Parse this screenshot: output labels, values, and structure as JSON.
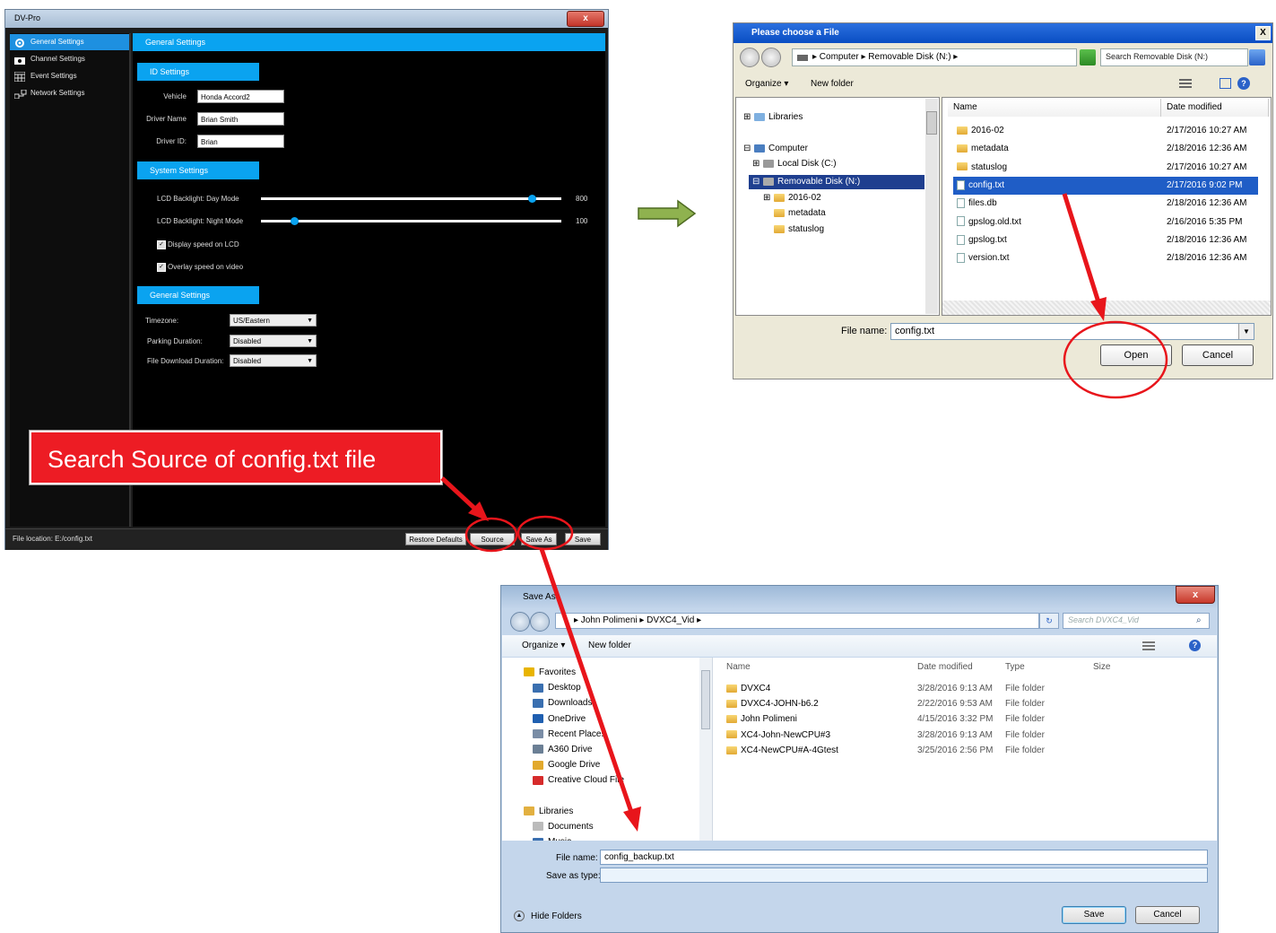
{
  "dvpro": {
    "title": "DV-Pro",
    "close_glyph": "x",
    "nav": [
      {
        "label": "General Settings",
        "icon": "gear-icon",
        "selected": true
      },
      {
        "label": "Channel Settings",
        "icon": "camera-icon",
        "selected": false
      },
      {
        "label": "Event Settings",
        "icon": "calendar-icon",
        "selected": false
      },
      {
        "label": "Network Settings",
        "icon": "network-icon",
        "selected": false
      }
    ],
    "header": "General Settings",
    "id_section": {
      "title": "ID Settings",
      "vehicle_label": "Vehicle",
      "vehicle_value": "Honda Accord2",
      "driver_name_label": "Driver Name",
      "driver_name_value": "Brian Smith",
      "driver_id_label": "Driver ID:",
      "driver_id_value": "Brian"
    },
    "system_section": {
      "title": "System Settings",
      "day_label": "LCD Backlight: Day Mode",
      "day_value": "800",
      "day_level": 0.9,
      "night_label": "LCD Backlight: Night Mode",
      "night_value": "100",
      "night_level": 0.11,
      "display_speed_label": "Display speed on LCD",
      "overlay_speed_label": "Overlay speed on video",
      "check_glyph": "✓"
    },
    "general_section": {
      "title": "General Settings",
      "timezone_label": "Timezone:",
      "timezone_value": "US/Eastern",
      "parking_label": "Parking Duration:",
      "parking_value": "Disabled",
      "download_label": "File Download Duration:",
      "download_value": "Disabled",
      "arrow_glyph": "▼"
    },
    "status": "File location: E:/config.txt",
    "buttons": {
      "restore": "Restore Defaults",
      "source": "Source",
      "saveas": "Save As",
      "save": "Save"
    }
  },
  "callout": "Search Source of config.txt file",
  "open_dialog": {
    "title": "Please choose a File",
    "close_glyph": "X",
    "breadcrumb": "▸ Computer ▸ Removable Disk (N:) ▸",
    "search_placeholder": "Search Removable Disk (N:)",
    "organize": "Organize ▾",
    "new_folder": "New folder",
    "tree": [
      {
        "label": "Libraries",
        "expander": "⊞"
      },
      {
        "label": "Computer",
        "expander": "⊟"
      },
      {
        "label": "Local Disk (C:)",
        "expander": "⊞"
      },
      {
        "label": "Removable Disk (N:)",
        "expander": "⊟"
      },
      {
        "label": "2016-02",
        "expander": "⊞"
      },
      {
        "label": "metadata",
        "expander": ""
      },
      {
        "label": "statuslog",
        "expander": ""
      }
    ],
    "col_name": "Name",
    "col_date": "Date modified",
    "files": [
      {
        "name": "2016-02",
        "date": "2/17/2016 10:27 AM",
        "kind": "folder"
      },
      {
        "name": "metadata",
        "date": "2/18/2016 12:36 AM",
        "kind": "folder"
      },
      {
        "name": "statuslog",
        "date": "2/17/2016 10:27 AM",
        "kind": "folder"
      },
      {
        "name": "config.txt",
        "date": "2/17/2016 9:02 PM",
        "kind": "file"
      },
      {
        "name": "files.db",
        "date": "2/18/2016 12:36 AM",
        "kind": "file"
      },
      {
        "name": "gpslog.old.txt",
        "date": "2/16/2016 5:35 PM",
        "kind": "file"
      },
      {
        "name": "gpslog.txt",
        "date": "2/18/2016 12:36 AM",
        "kind": "file"
      },
      {
        "name": "version.txt",
        "date": "2/18/2016 12:36 AM",
        "kind": "file"
      }
    ],
    "filename_label": "File name:",
    "filename_value": "config.txt",
    "open_button": "Open",
    "cancel_button": "Cancel"
  },
  "save_dialog": {
    "title": "Save As",
    "close_glyph": "x",
    "breadcrumb": "▸ John Polimeni ▸ DVXC4_Vid ▸",
    "search_placeholder": "Search DVXC4_Vid",
    "organize": "Organize ▾",
    "new_folder": "New folder",
    "nav": [
      {
        "label": "Favorites",
        "color": "#e8b400"
      },
      {
        "label": "Desktop",
        "color": "#3a6fb0"
      },
      {
        "label": "Downloads",
        "color": "#3a6fb0"
      },
      {
        "label": "OneDrive",
        "color": "#1f5fb0"
      },
      {
        "label": "Recent Places",
        "color": "#7a8da6"
      },
      {
        "label": "A360 Drive",
        "color": "#6b7f95"
      },
      {
        "label": "Google Drive",
        "color": "#e2a92c"
      },
      {
        "label": "Creative Cloud File",
        "color": "#d62b2b"
      },
      {
        "label": "",
        "color": "transparent"
      },
      {
        "label": "Libraries",
        "color": "#e2b040"
      },
      {
        "label": "Documents",
        "color": "#bbbbbb"
      },
      {
        "label": "Music",
        "color": "#3a6fb0"
      }
    ],
    "columns": {
      "name": "Name",
      "date": "Date modified",
      "type": "Type",
      "size": "Size"
    },
    "folders": [
      {
        "name": "DVXC4",
        "date": "3/28/2016 9:13 AM",
        "type": "File folder"
      },
      {
        "name": "DVXC4-JOHN-b6.2",
        "date": "2/22/2016 9:53 AM",
        "type": "File folder"
      },
      {
        "name": "John Polimeni",
        "date": "4/15/2016 3:32 PM",
        "type": "File folder"
      },
      {
        "name": "XC4-John-NewCPU#3",
        "date": "3/28/2016 9:13 AM",
        "type": "File folder"
      },
      {
        "name": "XC4-NewCPU#A-4Gtest",
        "date": "3/25/2016 2:56 PM",
        "type": "File folder"
      }
    ],
    "filename_label": "File name:",
    "filename_value": "config_backup.txt",
    "savetype_label": "Save as type:",
    "savetype_value": "",
    "hide_folders": "Hide Folders",
    "save_button": "Save",
    "cancel_button": "Cancel"
  },
  "colors": {
    "accent_blue": "#0aa3f0",
    "annotation_red": "#ed1c24",
    "arrow_green": "#8fb24f"
  }
}
